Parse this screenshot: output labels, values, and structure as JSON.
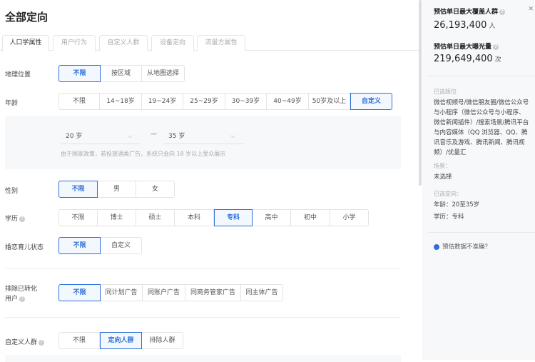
{
  "title": "全部定向",
  "tabs": [
    "人口学属性",
    "用户行为",
    "自定义人群",
    "设备定向",
    "流量方属性"
  ],
  "geo": {
    "label": "地理位置",
    "options": [
      "不限",
      "按区域",
      "从地图选择"
    ]
  },
  "age": {
    "label": "年龄",
    "options": [
      "不限",
      "14~18岁",
      "19~24岁",
      "25~29岁",
      "30~39岁",
      "40~49岁",
      "50岁及以上",
      "自定义"
    ],
    "from": "20 岁",
    "to": "35 岁",
    "dash": "—",
    "note": "由于国家政策，若投放酒类广告，系统只会向 18 岁以上受众展示"
  },
  "gender": {
    "label": "性别",
    "options": [
      "不限",
      "男",
      "女"
    ]
  },
  "edu": {
    "label": "学历",
    "options": [
      "不限",
      "博士",
      "硕士",
      "本科",
      "专科",
      "高中",
      "初中",
      "小学"
    ]
  },
  "marriage": {
    "label": "婚恋育儿状态",
    "options": [
      "不限",
      "自定义"
    ]
  },
  "exclude": {
    "label1": "排除已转化",
    "label2": "用户",
    "options": [
      "不限",
      "同计划广告",
      "同账户广告",
      "同商务管家广告",
      "同主体广告"
    ]
  },
  "custom": {
    "label": "自定义人群",
    "options": [
      "不限",
      "定向人群",
      "排除人群"
    ]
  },
  "side": {
    "cover_title": "预估单日最大覆盖人群",
    "cover_value": "26,193,400",
    "cover_unit": "人",
    "exp_title": "预估单日最大曝光量",
    "exp_value": "219,649,400",
    "exp_unit": "次",
    "placement_label": "已选版位",
    "placement": "微信视频号/微信朋友圈/微信公众号与小程序（微信公众号与小程序、微信新闻插件）/搜索场景/腾讯平台与内容媒体（QQ 浏览器、QQ、腾讯音乐及游戏、腾讯新闻、腾讯视频）/优量汇",
    "scene_label": "场景：",
    "scene": "未选择",
    "targeting_label": "已选定向：",
    "targeting_age": "年龄：20至35岁",
    "targeting_edu": "学历：专科",
    "feedback": "预估数据不准确？"
  }
}
